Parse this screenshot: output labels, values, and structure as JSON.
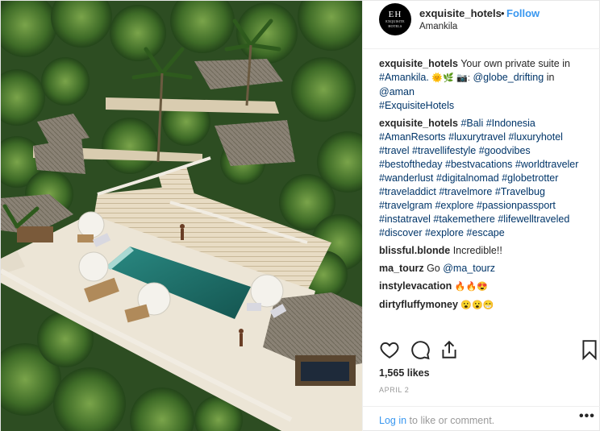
{
  "post": {
    "username": "exquisite_hotels",
    "follow_label": "Follow",
    "separator": "•",
    "location": "Amankila",
    "avatar_monogram": "EH",
    "avatar_subtext": "EXQUISITE HOTELS"
  },
  "caption": {
    "username": "exquisite_hotels",
    "text1": "Your own private suite in",
    "tag1": "#Amankila.",
    "emoji1": "🌞🌿",
    "emoji2": "📷:",
    "mention1": "@globe_drifting",
    "text2": "in",
    "mention2": "@aman",
    "tag2": "#ExquisiteHotels"
  },
  "hashtag_comment": {
    "username": "exquisite_hotels",
    "tags": [
      "#Bali",
      "#Indonesia",
      "#AmanResorts",
      "#luxurytravel",
      "#luxuryhotel",
      "#travel",
      "#travellifestyle",
      "#goodvibes",
      "#bestoftheday",
      "#bestvacations",
      "#worldtraveler",
      "#wanderlust",
      "#digitalnomad",
      "#globetrotter",
      "#traveladdict",
      "#travelmore",
      "#Travelbug",
      "#travelgram",
      "#explore",
      "#passionpassport",
      "#instatravel",
      "#takemethere",
      "#lifewelltraveled",
      "#discover",
      "#explore",
      "#escape"
    ]
  },
  "comments": [
    {
      "username": "blissful.blonde",
      "text": "Incredible!!"
    },
    {
      "username": "ma_tourz",
      "text": "Go",
      "mention": "@ma_tourz"
    },
    {
      "username": "instylevacation",
      "text": "🔥🔥😍"
    },
    {
      "username": "dirtyfluffymoney",
      "text": "😮😮😁"
    }
  ],
  "actions": {
    "like_icon": "heart-icon",
    "comment_icon": "comment-bubble-icon",
    "share_icon": "share-icon",
    "save_icon": "bookmark-icon"
  },
  "likes_label": "1,565 likes",
  "date_label": "APRIL 2",
  "footer": {
    "login_link": "Log in",
    "login_text": "to like or comment.",
    "more_icon": "•••"
  },
  "colors": {
    "link_blue": "#3897f0",
    "hashtag_blue": "#003569",
    "muted_gray": "#999999",
    "pool_teal": "#1f6f6a"
  }
}
